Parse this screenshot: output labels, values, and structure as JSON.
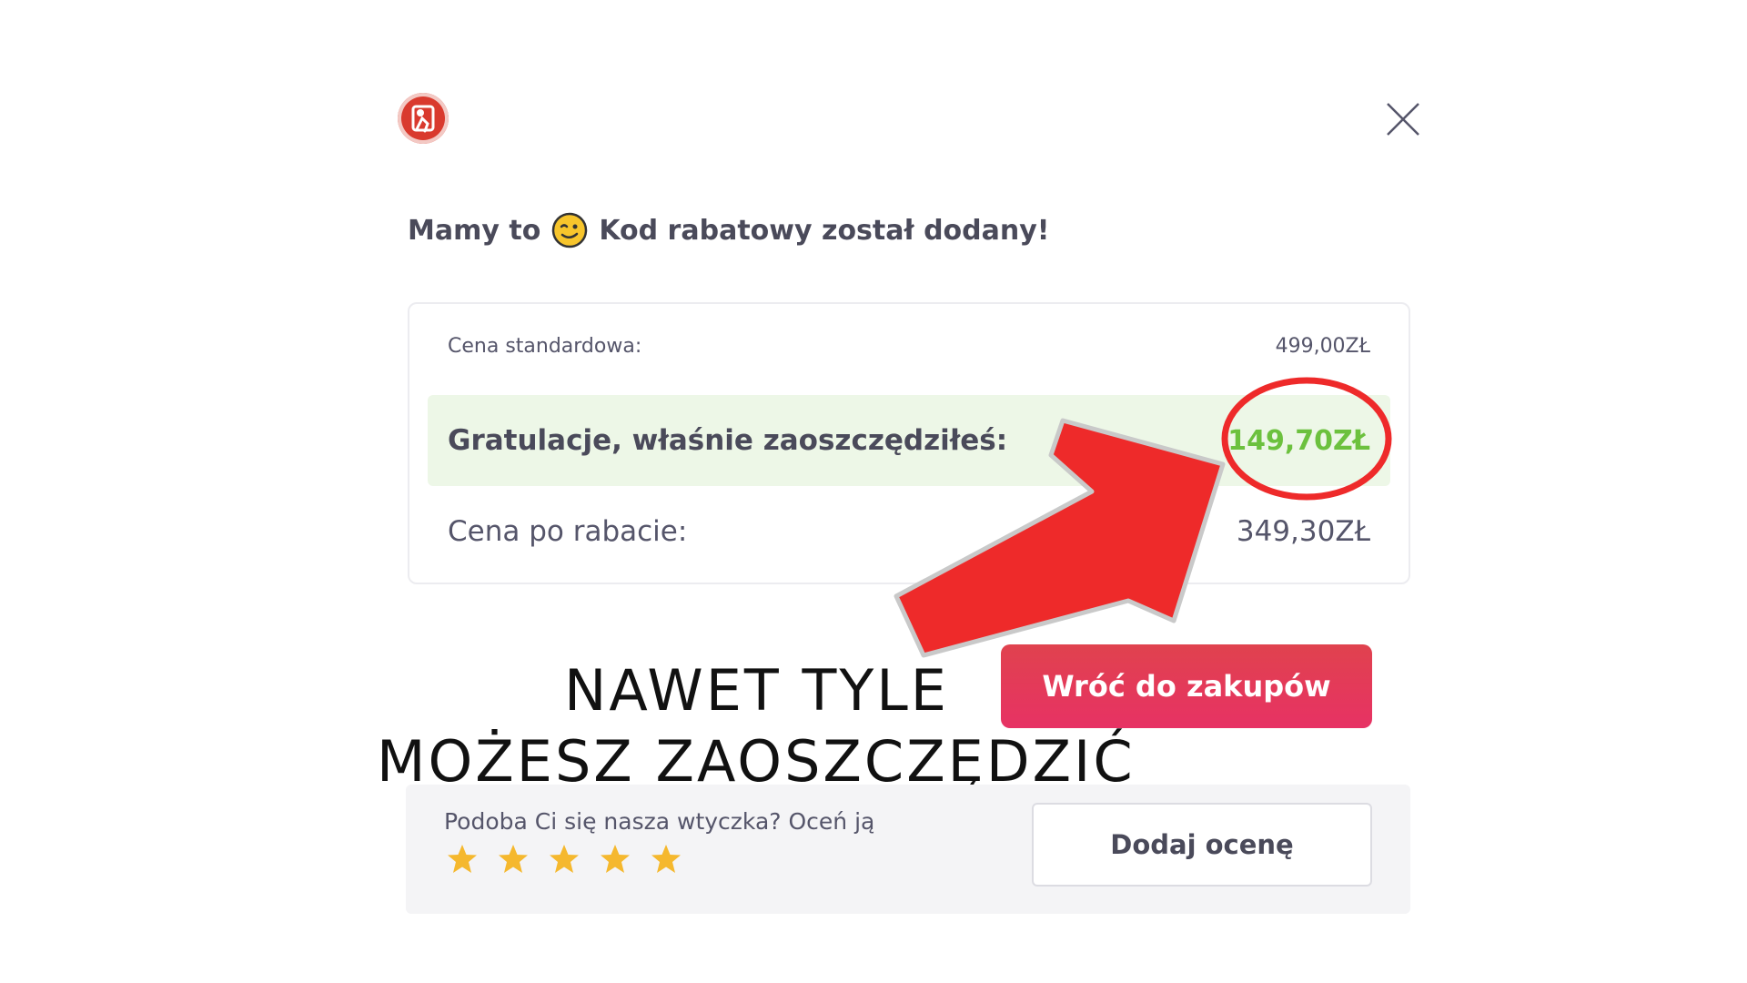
{
  "header": {
    "logo_icon": "plugin-logo-icon",
    "close_icon": "close-icon"
  },
  "headline": {
    "prefix": "Mamy to",
    "emoji_icon": "winking-face-emoji",
    "suffix": "Kod rabatowy został dodany!"
  },
  "prices": {
    "standard_label": "Cena standardowa:",
    "standard_value": "499,00ZŁ",
    "saved_label": "Gratulacje, właśnie zaoszczędziłeś:",
    "saved_value": "149,70ZŁ",
    "final_label": "Cena po rabacie:",
    "final_value": "349,30ZŁ"
  },
  "back_button": {
    "label": "Wróć do zakupów"
  },
  "callout": {
    "line1": "NAWET TYLE",
    "line2": "MOŻESZ ZAOSZCZĘDZIĆ"
  },
  "rating": {
    "prompt": "Podoba Ci się nasza wtyczka? Oceń ją",
    "stars": 5,
    "button_label": "Dodaj ocenę"
  },
  "colors": {
    "accent_red": "#e73264",
    "saved_green": "#6cc13e",
    "saved_bg": "#edf7e7",
    "arrow_red": "#ee2a2a",
    "star_yellow": "#f5b82e"
  }
}
